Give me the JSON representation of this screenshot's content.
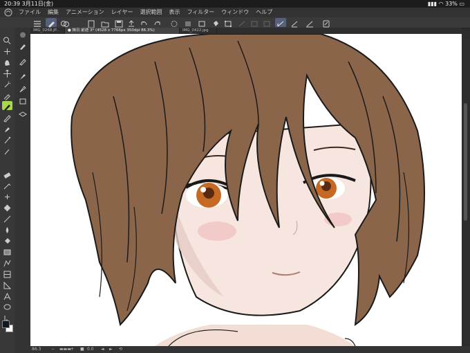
{
  "status": {
    "time": "20:39",
    "date": "3月11日(金)",
    "battery": "33%"
  },
  "menu": {
    "items": [
      "ファイル",
      "編集",
      "アニメーション",
      "レイヤー",
      "選択範囲",
      "表示",
      "フィルター",
      "ウィンドウ",
      "ヘルプ"
    ]
  },
  "tabs": [
    {
      "label": "IMG_0268.JP..."
    },
    {
      "label": "● 妹日 前途 3* (4528 x 7766px 350dpi 86.3%)"
    },
    {
      "label": "IMG_0422.jpg"
    }
  ],
  "bottom": {
    "zoom": "86.3",
    "rotation": "0.0"
  },
  "colors": {
    "accent": "#a7d94a",
    "ui_dark": "#2b2b2b",
    "hair": "#8a6549",
    "skin": "#f7e6df",
    "eye": "#c46a24"
  }
}
